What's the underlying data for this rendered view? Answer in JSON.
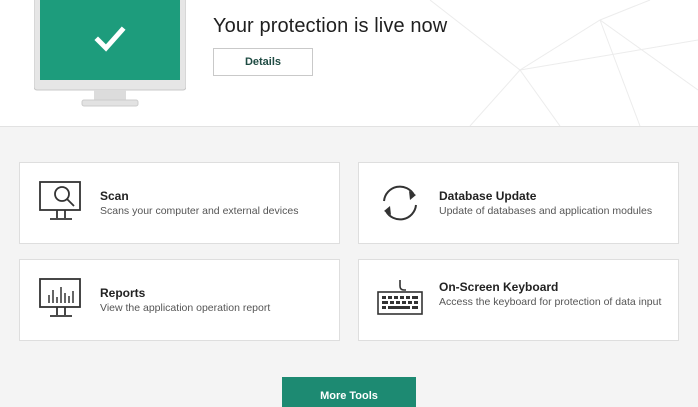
{
  "status": {
    "title": "Your protection is live now",
    "details_label": "Details",
    "state_icon": "check-mark-icon",
    "accent_color": "#1d9c7c"
  },
  "tools": [
    {
      "name": "Scan",
      "description": "Scans your computer and external devices",
      "icon": "scan-monitor-icon"
    },
    {
      "name": "Database Update",
      "description": "Update of databases and application modules",
      "icon": "refresh-arrows-icon"
    },
    {
      "name": "Reports",
      "description": "View the application operation report",
      "icon": "reports-chart-icon"
    },
    {
      "name": "On-Screen Keyboard",
      "description": "Access the keyboard for protection of data input",
      "icon": "keyboard-icon"
    }
  ],
  "more_tools_label": "More Tools",
  "colors": {
    "primary_button": "#1d8a72",
    "background": "#f4f4f4"
  }
}
